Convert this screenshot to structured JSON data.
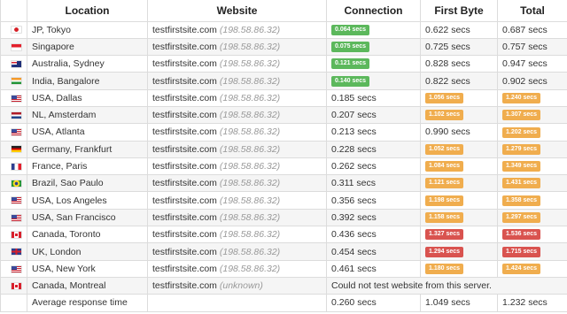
{
  "headers": {
    "location": "Location",
    "website": "Website",
    "connection": "Connection",
    "first_byte": "First Byte",
    "total": "Total"
  },
  "rows": [
    {
      "flag_icon": "japan-flag-icon",
      "location": "JP, Tokyo",
      "host": "testfirstsite.com",
      "ip": "(198.58.86.32)",
      "connection": "0.064 secs",
      "connection_status": "green",
      "first_byte": "0.622 secs",
      "total": "0.687 secs"
    },
    {
      "flag_icon": "singapore-flag-icon",
      "location": "Singapore",
      "host": "testfirstsite.com",
      "ip": "(198.58.86.32)",
      "connection": "0.075 secs",
      "connection_status": "green",
      "first_byte": "0.725 secs",
      "total": "0.757 secs"
    },
    {
      "flag_icon": "australia-flag-icon",
      "location": "Australia, Sydney",
      "host": "testfirstsite.com",
      "ip": "(198.58.86.32)",
      "connection": "0.121 secs",
      "connection_status": "green",
      "first_byte": "0.828 secs",
      "total": "0.947 secs"
    },
    {
      "flag_icon": "india-flag-icon",
      "location": "India, Bangalore",
      "host": "testfirstsite.com",
      "ip": "(198.58.86.32)",
      "connection": "0.140 secs",
      "connection_status": "green",
      "first_byte": "0.822 secs",
      "total": "0.902 secs"
    },
    {
      "flag_icon": "usa-flag-icon",
      "location": "USA, Dallas",
      "host": "testfirstsite.com",
      "ip": "(198.58.86.32)",
      "connection": "0.185 secs",
      "first_byte": "1.056 secs",
      "first_byte_status": "orange",
      "total": "1.240 secs",
      "total_status": "orange"
    },
    {
      "flag_icon": "netherlands-flag-icon",
      "location": "NL, Amsterdam",
      "host": "testfirstsite.com",
      "ip": "(198.58.86.32)",
      "connection": "0.207 secs",
      "first_byte": "1.102 secs",
      "first_byte_status": "orange",
      "total": "1.307 secs",
      "total_status": "orange"
    },
    {
      "flag_icon": "usa-flag-icon",
      "location": "USA, Atlanta",
      "host": "testfirstsite.com",
      "ip": "(198.58.86.32)",
      "connection": "0.213 secs",
      "first_byte": "0.990 secs",
      "total": "1.202 secs",
      "total_status": "orange"
    },
    {
      "flag_icon": "germany-flag-icon",
      "location": "Germany, Frankfurt",
      "host": "testfirstsite.com",
      "ip": "(198.58.86.32)",
      "connection": "0.228 secs",
      "first_byte": "1.052 secs",
      "first_byte_status": "orange",
      "total": "1.279 secs",
      "total_status": "orange"
    },
    {
      "flag_icon": "france-flag-icon",
      "location": "France, Paris",
      "host": "testfirstsite.com",
      "ip": "(198.58.86.32)",
      "connection": "0.262 secs",
      "first_byte": "1.084 secs",
      "first_byte_status": "orange",
      "total": "1.349 secs",
      "total_status": "orange"
    },
    {
      "flag_icon": "brazil-flag-icon",
      "location": "Brazil, Sao Paulo",
      "host": "testfirstsite.com",
      "ip": "(198.58.86.32)",
      "connection": "0.311 secs",
      "first_byte": "1.121 secs",
      "first_byte_status": "orange",
      "total": "1.431 secs",
      "total_status": "orange"
    },
    {
      "flag_icon": "usa-flag-icon",
      "location": "USA, Los Angeles",
      "host": "testfirstsite.com",
      "ip": "(198.58.86.32)",
      "connection": "0.356 secs",
      "first_byte": "1.198 secs",
      "first_byte_status": "orange",
      "total": "1.358 secs",
      "total_status": "orange"
    },
    {
      "flag_icon": "usa-flag-icon",
      "location": "USA, San Francisco",
      "host": "testfirstsite.com",
      "ip": "(198.58.86.32)",
      "connection": "0.392 secs",
      "first_byte": "1.158 secs",
      "first_byte_status": "orange",
      "total": "1.297 secs",
      "total_status": "orange"
    },
    {
      "flag_icon": "canada-flag-icon",
      "location": "Canada, Toronto",
      "host": "testfirstsite.com",
      "ip": "(198.58.86.32)",
      "connection": "0.436 secs",
      "first_byte": "1.327 secs",
      "first_byte_status": "red",
      "total": "1.536 secs",
      "total_status": "red"
    },
    {
      "flag_icon": "uk-flag-icon",
      "location": "UK, London",
      "host": "testfirstsite.com",
      "ip": "(198.58.86.32)",
      "connection": "0.454 secs",
      "first_byte": "1.294 secs",
      "first_byte_status": "red",
      "total": "1.715 secs",
      "total_status": "red"
    },
    {
      "flag_icon": "usa-flag-icon",
      "location": "USA, New York",
      "host": "testfirstsite.com",
      "ip": "(198.58.86.32)",
      "connection": "0.461 secs",
      "first_byte": "1.180 secs",
      "first_byte_status": "orange",
      "total": "1.424 secs",
      "total_status": "orange"
    },
    {
      "flag_icon": "canada-flag-icon",
      "location": "Canada, Montreal",
      "host": "testfirstsite.com",
      "ip": "(unknown)",
      "error": "Could not test website from this server."
    }
  ],
  "average": {
    "label": "Average response time",
    "connection": "0.260 secs",
    "first_byte": "1.049 secs",
    "total": "1.232 secs"
  },
  "colors": {
    "green": "#5cb85c",
    "orange": "#f0ad4e",
    "red": "#d9534f"
  }
}
